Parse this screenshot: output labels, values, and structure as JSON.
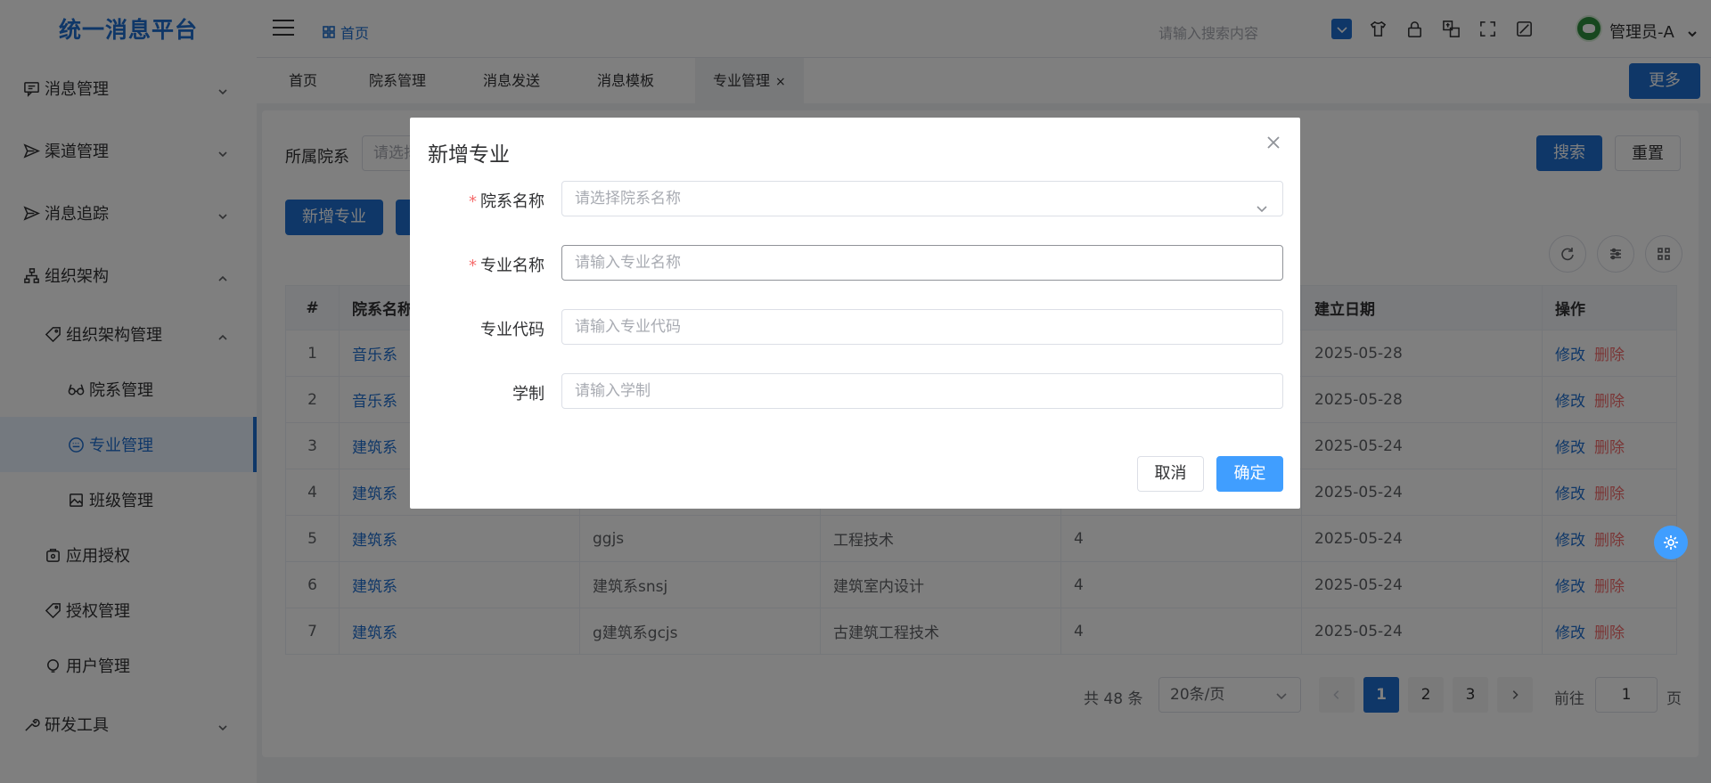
{
  "app": {
    "title": "统一消息平台"
  },
  "header": {
    "breadcrumb": "首页",
    "search_placeholder": "请输入搜索内容",
    "user_name": "管理员-A"
  },
  "sidebar": {
    "items": [
      {
        "label": "消息管理",
        "icon": "message-icon"
      },
      {
        "label": "渠道管理",
        "icon": "send-icon"
      },
      {
        "label": "消息追踪",
        "icon": "send-icon"
      },
      {
        "label": "组织架构",
        "icon": "org-icon"
      },
      {
        "label": "组织架构管理",
        "icon": "tag-icon"
      },
      {
        "label": "院系管理",
        "icon": "glasses-icon"
      },
      {
        "label": "专业管理",
        "icon": "keyboard-icon"
      },
      {
        "label": "班级管理",
        "icon": "picture-icon"
      },
      {
        "label": "应用授权",
        "icon": "app-icon"
      },
      {
        "label": "授权管理",
        "icon": "tag-icon"
      },
      {
        "label": "用户管理",
        "icon": "user-icon"
      },
      {
        "label": "研发工具",
        "icon": "tool-icon"
      }
    ]
  },
  "tabs": {
    "items": [
      "首页",
      "院系管理",
      "消息发送",
      "消息模板",
      "专业管理"
    ],
    "close_glyph": "×",
    "more": "更多"
  },
  "filter": {
    "label": "所属院系",
    "placeholder": "请选择",
    "search": "搜索",
    "reset": "重置",
    "add": "新增专业"
  },
  "table": {
    "columns": [
      "#",
      "院系名称",
      "",
      "",
      "",
      "建立日期",
      "操作"
    ],
    "rows": [
      {
        "no": "1",
        "dept": "音乐系",
        "code": "",
        "name": "",
        "years": "",
        "date": "2025-05-28"
      },
      {
        "no": "2",
        "dept": "音乐系",
        "code": "",
        "name": "",
        "years": "",
        "date": "2025-05-28"
      },
      {
        "no": "3",
        "dept": "建筑系",
        "code": "",
        "name": "",
        "years": "",
        "date": "2025-05-24"
      },
      {
        "no": "4",
        "dept": "建筑系",
        "code": "",
        "name": "",
        "years": "",
        "date": "2025-05-24"
      },
      {
        "no": "5",
        "dept": "建筑系",
        "code": "ggjs",
        "name": "工程技术",
        "years": "4",
        "date": "2025-05-24"
      },
      {
        "no": "6",
        "dept": "建筑系",
        "code": "建筑系snsj",
        "name": "建筑室内设计",
        "years": "4",
        "date": "2025-05-24"
      },
      {
        "no": "7",
        "dept": "建筑系",
        "code": "g建筑系gcjs",
        "name": "古建筑工程技术",
        "years": "4",
        "date": "2025-05-24"
      }
    ],
    "edit": "修改",
    "delete": "删除"
  },
  "pagination": {
    "total": "共 48 条",
    "page_size": "20条/页",
    "pages": [
      "1",
      "2",
      "3"
    ],
    "current": "1",
    "goto_label": "前往",
    "goto_value": "1",
    "page_suffix": "页"
  },
  "dialog": {
    "title": "新增专业",
    "fields": [
      {
        "label": "院系名称",
        "required": "*",
        "placeholder": "请选择院系名称"
      },
      {
        "label": "专业名称",
        "required": "*",
        "placeholder": "请输入专业名称"
      },
      {
        "label": "专业代码",
        "required": "",
        "placeholder": "请输入专业代码"
      },
      {
        "label": "学制",
        "required": "",
        "placeholder": "请输入学制"
      }
    ],
    "cancel": "取消",
    "ok": "确定"
  },
  "colors": {
    "primary": "#1f6fd0",
    "accent": "#409eff",
    "danger": "#f56c6c"
  }
}
